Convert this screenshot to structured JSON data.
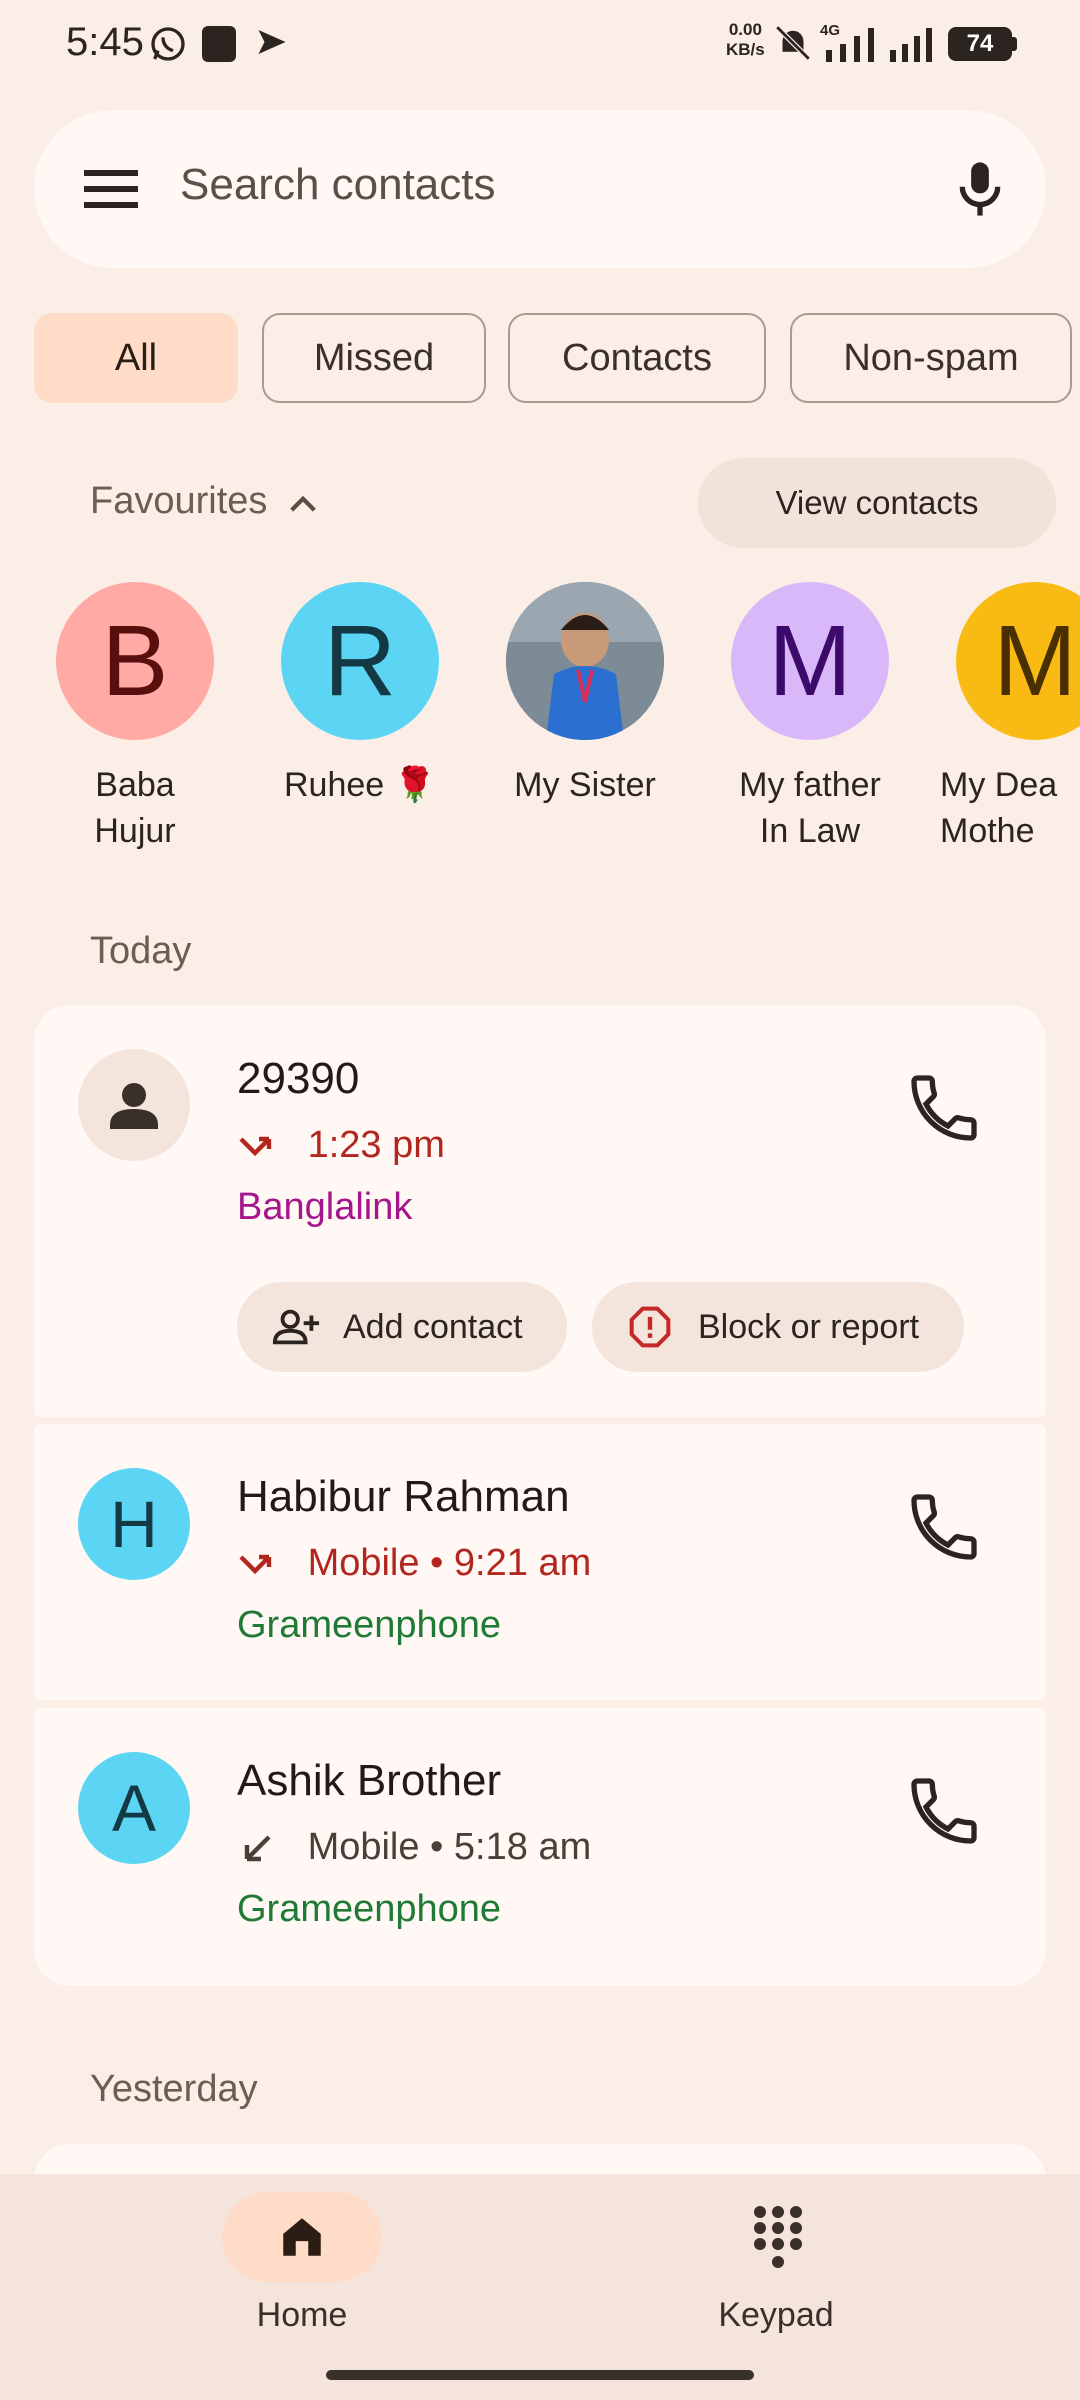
{
  "status_bar": {
    "time": "5:45",
    "net_speed_value": "0.00",
    "net_speed_unit": "KB/s",
    "network_type": "4G",
    "battery": "74"
  },
  "search": {
    "placeholder": "Search contacts"
  },
  "filters": [
    {
      "label": "All",
      "active": true
    },
    {
      "label": "Missed",
      "active": false
    },
    {
      "label": "Contacts",
      "active": false
    },
    {
      "label": "Non-spam",
      "active": false
    }
  ],
  "favourites": {
    "title": "Favourites",
    "view_contacts_label": "View contacts",
    "items": [
      {
        "initial": "B",
        "name_line1": "Baba",
        "name_line2": "Hujur",
        "color": "#FFAAA4",
        "text_color": "#5a0f0f"
      },
      {
        "initial": "R",
        "name_line1": "Ruhee 🌹",
        "name_line2": "",
        "color": "#5CD5F5",
        "text_color": "#133a44"
      },
      {
        "initial": "",
        "name_line1": "My Sister",
        "name_line2": "",
        "color": "#6c7a88",
        "text_color": "#ffffff"
      },
      {
        "initial": "M",
        "name_line1": "My father",
        "name_line2": "In Law",
        "color": "#D9B8FA",
        "text_color": "#3b0a6b"
      },
      {
        "initial": "M",
        "name_line1": "My Dea",
        "name_line2": "Mothe",
        "color": "#F9BA13",
        "text_color": "#4a2f00"
      }
    ]
  },
  "sections": {
    "today": "Today",
    "yesterday": "Yesterday"
  },
  "calls": [
    {
      "name": "29390",
      "meta": "1:23 pm",
      "carrier": "Banglalink",
      "missed": true,
      "carrier_color": "#A5158C",
      "add_contact_label": "Add contact",
      "block_label": "Block or report"
    },
    {
      "initial": "H",
      "name": "Habibur Rahman",
      "meta": "Mobile • 9:21 am",
      "carrier": "Grameenphone",
      "missed": true,
      "carrier_color": "#1F7A36"
    },
    {
      "initial": "A",
      "name": "Ashik Brother",
      "meta": "Mobile • 5:18 am",
      "carrier": "Grameenphone",
      "missed": false,
      "carrier_color": "#1F7A36"
    }
  ],
  "bottom_nav": {
    "home_label": "Home",
    "keypad_label": "Keypad"
  },
  "colors": {
    "missed": "#B3261E",
    "accent_chip": "#FFDCC8"
  }
}
